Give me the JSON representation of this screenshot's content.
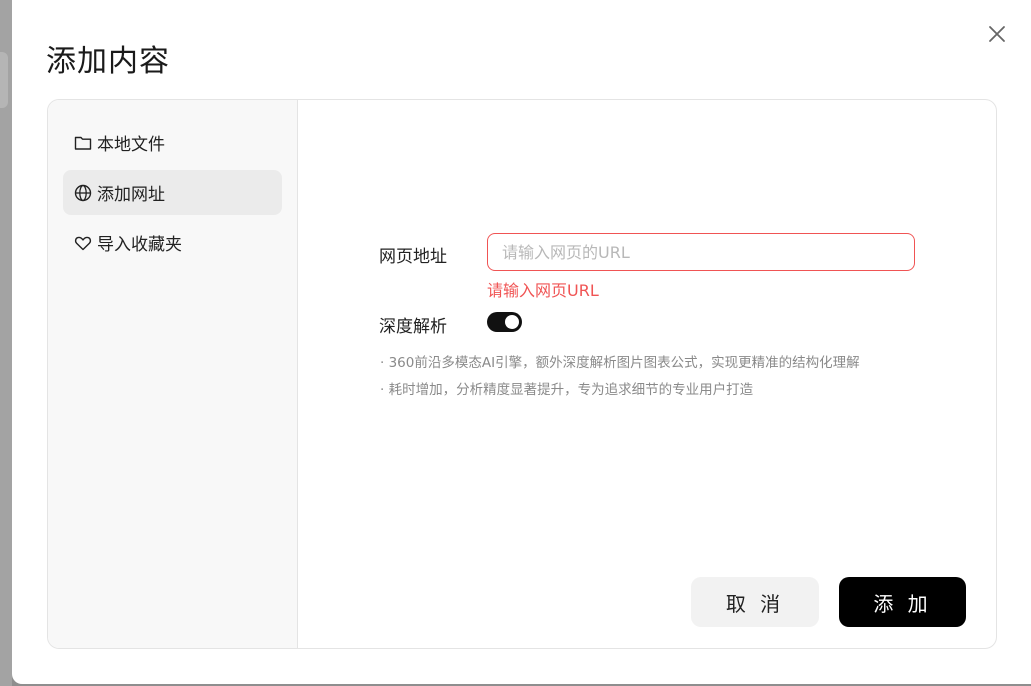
{
  "dialog": {
    "title": "添加内容",
    "close_icon": "close-icon"
  },
  "sidebar": {
    "items": [
      {
        "label": "本地文件",
        "icon": "folder-icon",
        "active": false
      },
      {
        "label": "添加网址",
        "icon": "globe-icon",
        "active": true
      },
      {
        "label": "导入收藏夹",
        "icon": "heart-icon",
        "active": false
      }
    ]
  },
  "form": {
    "url_label": "网页地址",
    "url_placeholder": "请输入网页的URL",
    "url_value": "",
    "url_error": "请输入网页URL",
    "deep_parse_label": "深度解析",
    "deep_parse_enabled": true,
    "descriptions": [
      "· 360前沿多模态AI引擎，额外深度解析图片图表公式，实现更精准的结构化理解",
      "· 耗时增加，分析精度显著提升，专为追求细节的专业用户打造"
    ]
  },
  "actions": {
    "cancel_label": "取 消",
    "add_label": "添 加"
  },
  "colors": {
    "error": "#f05454",
    "primary_button": "#000000",
    "toggle_on": "#111111"
  }
}
